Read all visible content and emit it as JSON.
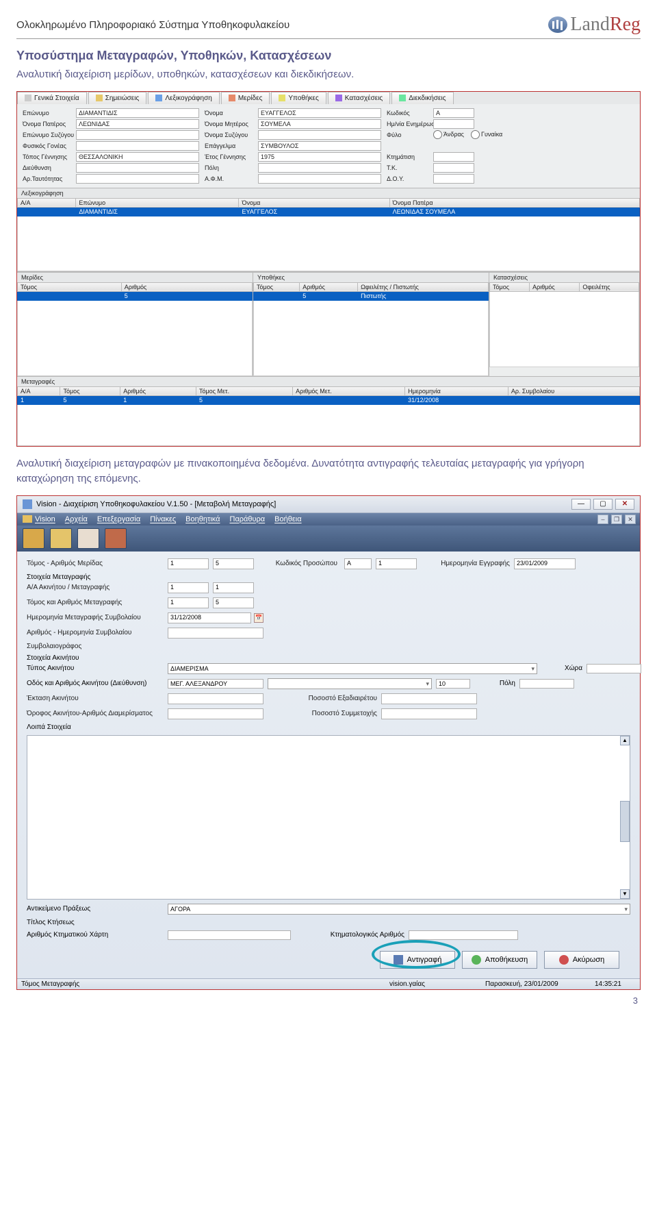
{
  "doc": {
    "header_left": "Ολοκληρωμένο Πληροφοριακό Σύστημα Υποθηκοφυλακείου",
    "logo_land": "Land",
    "logo_reg": "Reg",
    "section_title": "Υποσύστημα Μεταγραφών, Υποθηκών, Κατασχέσεων",
    "para1": "Αναλυτική διαχείριση μερίδων, υποθηκών, κατασχέσεων και διεκδικήσεων.",
    "para2": "Αναλυτική διαχείριση μεταγραφών με πινακοποιημένα δεδομένα. Δυνατότητα αντιγραφής τελευταίας μεταγραφής για γρήγορη καταχώρηση της επόμενης.",
    "page_num": "3"
  },
  "shot1": {
    "tabs": [
      "Γενικά Στοιχεία",
      "Σημειώσεις",
      "Λεξικογράφηση",
      "Μερίδες",
      "Υποθήκες",
      "Κατασχέσεις",
      "Διεκδικήσεις"
    ],
    "labels": {
      "eponymo": "Επώνυμο",
      "onoma": "Όνομα",
      "kodikos": "Κωδικός",
      "onpateros": "Όνομα Πατέρος",
      "onmitros": "Όνομα Μητέρος",
      "hmenim": "Ημ/νία Ενημέρωσης",
      "epsyz": "Επώνυμο Συζύγου",
      "onsyz": "Όνομα Συζύγου",
      "fylo": "Φύλο",
      "andras": "Άνδρας",
      "gynaika": "Γυναίκα",
      "fgoneas": "Φυσικός Γονέας",
      "epagg": "Επάγγελμα",
      "topgenn": "Τόπος Γέννησης",
      "etosgenn": "Έτος Γέννησης",
      "ktimatisi": "Κτημάτιση",
      "dieyth": "Διεύθυνση",
      "poli": "Πόλη",
      "tk": "Τ.Κ.",
      "artaut": "Αρ.Ταυτότητας",
      "afm": "Α.Φ.Μ.",
      "doy": "Δ.Ο.Υ."
    },
    "fields": {
      "eponymo": "ΔΙΑΜΑΝΤΙΔΙΣ",
      "onoma": "ΕΥΑΓΓΕΛΟΣ",
      "kodikos": "Α",
      "onpateros": "ΛΕΩΝΙΔΑΣ",
      "onmitros": "ΣΟΥΜΕΛΑ",
      "epagg": "ΣΥΜΒΟΥΛΟΣ",
      "topgenn": "ΘΕΣΣΑΛΟΝΙΚΗ",
      "etosgenn": "1975"
    },
    "lex_header": "Λεξικογράφηση",
    "lex_cols": [
      "Α/Α",
      "Επώνυμο",
      "Όνομα",
      "Όνομα Πατέρα"
    ],
    "lex_row": [
      "",
      "ΔΙΑΜΑΝΤΙΔΙΣ",
      "ΕΥΑΓΓΕΛΟΣ",
      "ΛΕΩΝΙΔΑΣ   ΣΟΥΜΕΛΑ"
    ],
    "merides_header": "Μερίδες",
    "merides_cols": [
      "Τόμος",
      "Αριθμός"
    ],
    "merides_row": [
      "",
      "5"
    ],
    "ypoth_header": "Υποθήκες",
    "ypoth_cols": [
      "Τόμος",
      "Αριθμός",
      "Ωφειλέτης / Πιστωτής"
    ],
    "ypoth_row": [
      "",
      "5",
      "Πιστωτής"
    ],
    "katasx_header": "Κατασχέσεις",
    "katasx_cols": [
      "Τόμος",
      "Αριθμός",
      "Οφειλέτης"
    ],
    "metag_header": "Μεταγραφές",
    "metag_cols": [
      "Α/Α",
      "Τόμος",
      "Αριθμός",
      "Τόμος Μετ.",
      "Αριθμός Μετ.",
      "Ημερομηνία",
      "Αρ. Συμβολαίου"
    ],
    "metag_row": [
      "1",
      "5",
      "1",
      "5",
      "",
      "31/12/2008",
      ""
    ]
  },
  "shot2": {
    "title": "Vision - Διαχείριση Υποθηκοφυλακείου V.1.50 - [Μεταβολή Μεταγραφής]",
    "menus": [
      "Vision",
      "Αρχεία",
      "Επεξεργασία",
      "Πίνακες",
      "Βοηθητικά",
      "Παράθυρα",
      "Βοήθεια"
    ],
    "lbl": {
      "tomos_arith": "Τόμος - Αριθμός Μερίδας",
      "kod_pros": "Κωδικός Προσώπου",
      "hm_eggr": "Ημερομηνία Εγγραφής",
      "st_metag": "Στοιχεία Μεταγραφής",
      "aa_akin": "Α/Α Ακινήτου / Μεταγραφής",
      "tom_ar_met": "Τόμος και Αριθμός Μεταγραφής",
      "hm_met": "Ημερομηνία Μεταγραφής Συμβολαίου",
      "ar_hm_symb": "Αριθμός - Ημερομηνία Συμβολαίου",
      "symbol": "Συμβολαιογράφος",
      "st_akin": "Στοιχεία Ακινήτου",
      "typ_akin": "Τύπος Ακινήτου",
      "odos": "Οδός και Αριθμός Ακινήτου (Διεύθυνση)",
      "ektasi": "Έκταση Ακινήτου",
      "pososto_ex": "Ποσοστό Εξαδιαιρέτου",
      "orofos": "Όροφος Ακινήτου-Αριθμός Διαμερίσματος",
      "pososto_sym": "Ποσοστό Συμμετοχής",
      "loipa": "Λοιπά Στοιχεία",
      "antik": "Αντικείμενο Πράξεως",
      "titlos": "Τίτλος Κτήσεως",
      "ar_ktima": "Αριθμός Κτηματικού Χάρτη",
      "ktima_ar": "Κτηματολογικός Αριθμός",
      "xwra": "Χώρα",
      "poli": "Πόλη",
      "tom_met_status": "Τόμος Μεταγραφής"
    },
    "vals": {
      "tomos1": "1",
      "arith": "5",
      "kodp": "Α",
      "kodp_n": "1",
      "hmeggr": "23/01/2009",
      "aa1": "1",
      "aa2": "1",
      "tm1": "1",
      "tm2": "5",
      "hmmet": "31/12/2008",
      "typ_akin": "ΔΙΑΜΕΡΙΣΜΑ",
      "odos": "ΜΕΓ. ΑΛΕΞΑΝΔΡΟΥ",
      "odos_n": "10",
      "antik": "ΑΓΟΡΑ",
      "status_user": "vision.γαίας",
      "status_date": "Παρασκευή, 23/01/2009",
      "status_time": "14:35:21"
    },
    "buttons": {
      "copy": "Αντιγραφή",
      "save": "Αποθήκευση",
      "cancel": "Ακύρωση"
    }
  }
}
